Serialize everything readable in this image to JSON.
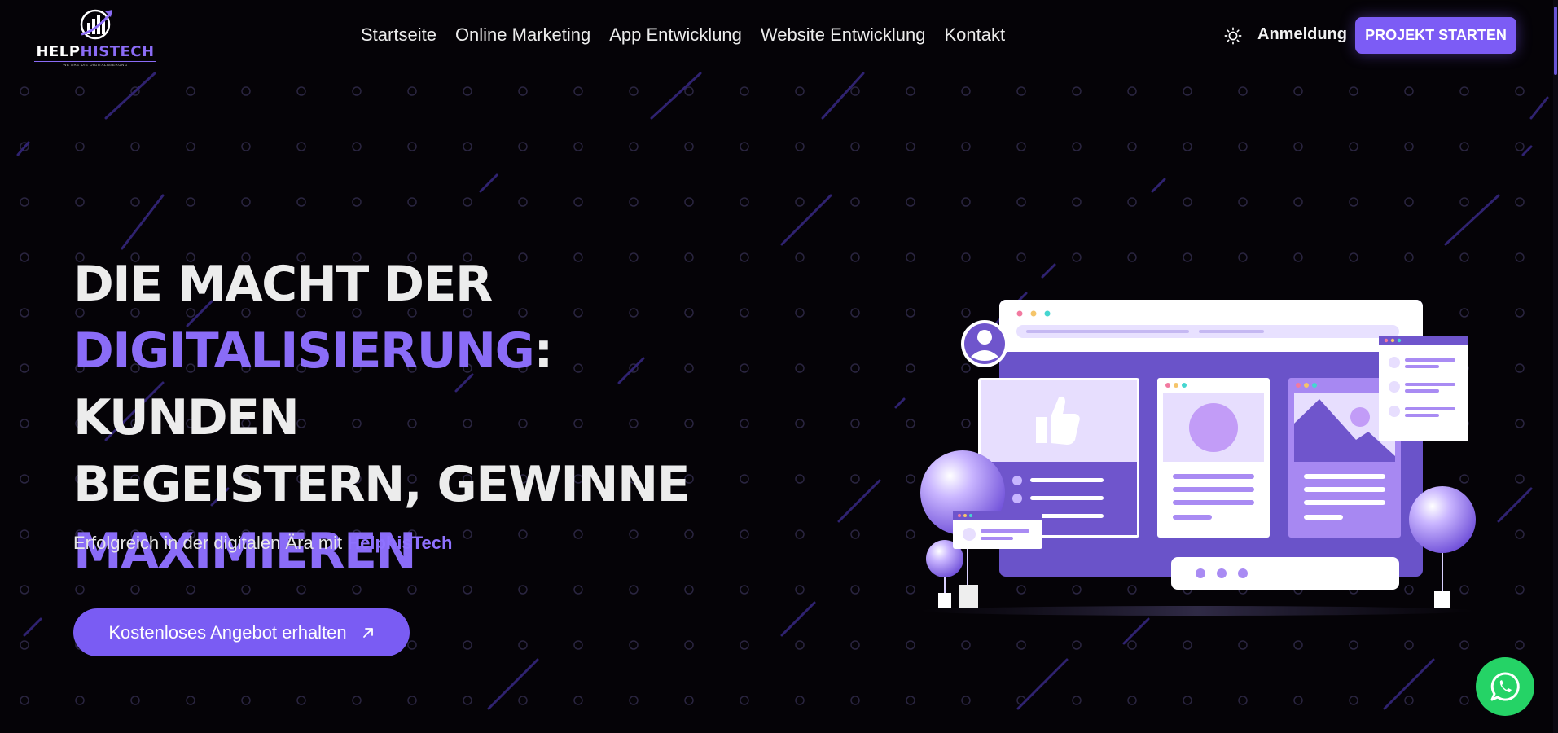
{
  "header": {
    "logo": {
      "prefix": "HELP",
      "suffix": "HISTECH",
      "tagline": "WE ARE DIE DIGITALISIERUNG",
      "icon": "chart-growth-logo-icon"
    },
    "nav": [
      {
        "label": "Startseite"
      },
      {
        "label": "Online Marketing"
      },
      {
        "label": "App Entwicklung"
      },
      {
        "label": "Website Entwicklung"
      },
      {
        "label": "Kontakt"
      }
    ],
    "theme_icon": "sun-icon",
    "login_label": "Anmeldung",
    "cta_label": "PROJEKT STARTEN"
  },
  "hero": {
    "title": {
      "line1": "DIE MACHT DER",
      "accent1": "DIGITALISIERUNG",
      "line2_rest": ": KUNDEN",
      "line3": "BEGEISTERN, GEWINNE",
      "accent2": "MAXIMIEREN"
    },
    "subtitle_prefix": "Erfolgreich in der digitalen Ära mit",
    "subtitle_brand": "HelphisTech",
    "button_label": "Kostenloses Angebot erhalten",
    "button_icon": "arrow-up-right-icon"
  },
  "illustration": {
    "name": "website-dashboard-illustration",
    "icons": [
      "user-avatar-icon",
      "thumbs-up-icon",
      "image-icon"
    ]
  },
  "floating": {
    "whatsapp_icon": "whatsapp-icon"
  },
  "colors": {
    "background": "#050307",
    "accent": "#7c5cf5",
    "accent_text": "#8a6cf7",
    "whatsapp": "#25d366"
  }
}
